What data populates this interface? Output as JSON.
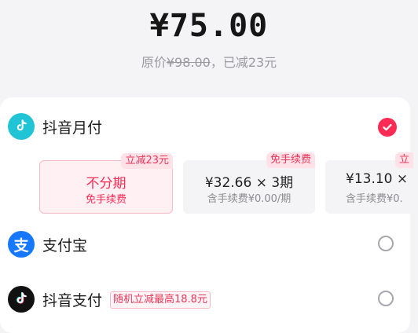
{
  "header": {
    "price": "¥75.00",
    "original_prefix": "原价",
    "original_price": "¥98.00",
    "discount_text": "，已减23元"
  },
  "payment_methods": [
    {
      "name": "抖音月付",
      "icon": "douyin-icon",
      "selected": true
    },
    {
      "name": "支付宝",
      "icon": "alipay-icon",
      "selected": false
    },
    {
      "name": "抖音支付",
      "icon": "douyin-icon",
      "selected": false,
      "promo": "随机立减最高18.8元"
    }
  ],
  "installment_plans": [
    {
      "line1": "不分期",
      "line2": "免手续费",
      "badge": "立减23元",
      "selected": true
    },
    {
      "line1": "¥32.66 × 3期",
      "line2": "含手续费¥0.00/期",
      "badge": "免手续费",
      "selected": false
    },
    {
      "line1": "¥13.10 ×",
      "line2": "含手续费¥0.",
      "badge": "立",
      "selected": false
    }
  ],
  "colors": {
    "accent": "#fe2c55",
    "alipay": "#1677ff",
    "douyin_teal": "#21c4d4"
  }
}
